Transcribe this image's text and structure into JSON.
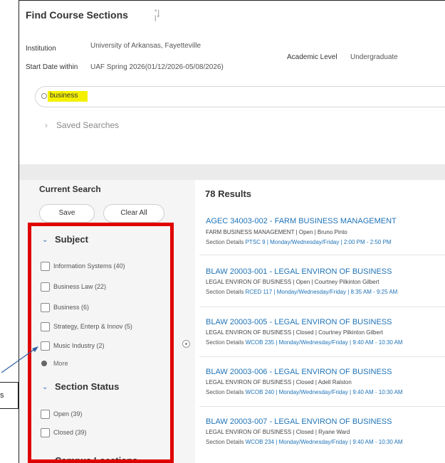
{
  "page": {
    "title": "Find Course Sections",
    "config_icon": "settings-toggle-icon"
  },
  "criteria": {
    "institution_label": "Institution",
    "institution_value": "University of Arkansas, Fayetteville",
    "start_label": "Start Date within",
    "start_value": "UAF Spring 2026(01/12/2026-05/08/2026)",
    "level_label": "Academic Level",
    "level_value": "Undergraduate"
  },
  "search": {
    "value": "business",
    "icon": "search-icon"
  },
  "saved_searches": {
    "label": "Saved Searches"
  },
  "current_search": {
    "title": "Current Search",
    "save_label": "Save",
    "clear_label": "Clear All"
  },
  "facets": {
    "subject": {
      "title": "Subject",
      "options": [
        "Information Systems (40)",
        "Business Law (22)",
        "Business (6)",
        "Strategy, Enterp & Innov (5)",
        "Music Industry (2)"
      ],
      "more_label": "More"
    },
    "section_status": {
      "title": "Section Status",
      "options": [
        "Open (39)",
        "Closed (39)"
      ]
    },
    "campus_locations": {
      "title": "Campus Locations"
    }
  },
  "results": {
    "count_label": "78 Results",
    "items": [
      {
        "title": "AGEC 34003-002 - FARM BUSINESS MANAGEMENT",
        "subtitle": "FARM BUSINESS MANAGEMENT  |  Open  |  Bruno Pinto",
        "details_label": "Section Details",
        "details": "PTSC 9 | Monday/Wednesday/Friday | 2:00 PM - 2:50 PM"
      },
      {
        "title": "BLAW 20003-001 - LEGAL ENVIRON OF BUSINESS",
        "subtitle": "LEGAL ENVIRON OF BUSINESS  |  Open  |  Courtney Pilkinton Gilbert",
        "details_label": "Section Details",
        "details": "RCED 117 | Monday/Wednesday/Friday | 8:35 AM - 9:25 AM"
      },
      {
        "title": "BLAW 20003-005 - LEGAL ENVIRON OF BUSINESS",
        "subtitle": "LEGAL ENVIRON OF BUSINESS  |  Closed  |  Courtney Pilkinton Gilbert",
        "details_label": "Section Details",
        "details": "WCOB 235 | Monday/Wednesday/Friday | 9:40 AM - 10:30 AM"
      },
      {
        "title": "BLAW 20003-006 - LEGAL ENVIRON OF BUSINESS",
        "subtitle": "LEGAL ENVIRON OF BUSINESS  |  Closed  |  Adell Ralston",
        "details_label": "Section Details",
        "details": "WCOB 240 | Monday/Wednesday/Friday | 9:40 AM - 10:30 AM"
      },
      {
        "title": "BLAW 20003-007 - LEGAL ENVIRON OF BUSINESS",
        "subtitle": "LEGAL ENVIRON OF BUSINESS  |  Closed  |  Ryane Ward",
        "details_label": "Section Details",
        "details": "WCOB 234 | Monday/Wednesday/Friday | 9:40 AM - 10:30 AM"
      }
    ]
  },
  "annotation": {
    "callout_text": "s"
  },
  "colors": {
    "highlight": "#f4f100",
    "callout_box": "#e00000",
    "link": "#1f73b7"
  }
}
